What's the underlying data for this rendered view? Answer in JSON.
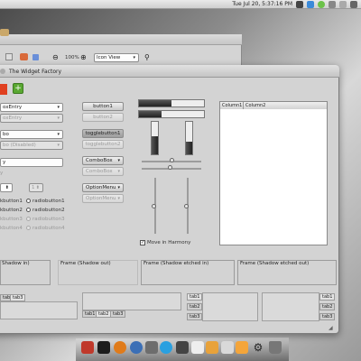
{
  "panel": {
    "clock": "Tue Jul 20,  5:37:16 PM"
  },
  "bg_window": {
    "zoom": "100%",
    "view": "Icon View"
  },
  "window": {
    "title": "The Widget Factory"
  },
  "left": {
    "combo_entry": "oxEntry",
    "combo_entry_dis": "oxEntry",
    "combo": "bo",
    "combo_dis": "bo (Disabled)",
    "entry": "y",
    "entry_dis": "y",
    "spin_val": "",
    "spin_val2": "1",
    "check1": "kbutton1",
    "check2": "kbutton2",
    "check3": "kbutton3",
    "check4": "kbutton4",
    "radio1": "radiobutton1",
    "radio2": "radiobutton2",
    "radio3": "radiobutton3",
    "radio4": "radiobutton4"
  },
  "buttons": {
    "b1": "button1",
    "b2": "button2",
    "t1": "togglebutton1",
    "t2": "togglebutton2",
    "cb1": "ComboBox",
    "cb2": "ComboBox",
    "om1": "OptionMenu",
    "om2": "OptionMenu"
  },
  "harmony": "Move in Harmony",
  "tree": {
    "col1": "Column1",
    "col2": "Column2"
  },
  "frames": {
    "f1": "Shadow in)",
    "f2": "Frame (Shadow out)",
    "f3": "Frame (Shadow etched in)",
    "f4": "Frame (Shadow etched out)"
  },
  "tabs": {
    "a": [
      "tab2",
      "tab3"
    ],
    "b": [
      "tab1",
      "tab2",
      "tab3"
    ],
    "c": [
      "tab1",
      "tab2",
      "tab3"
    ],
    "d": [
      "tab1",
      "tab2",
      "tab3"
    ]
  }
}
